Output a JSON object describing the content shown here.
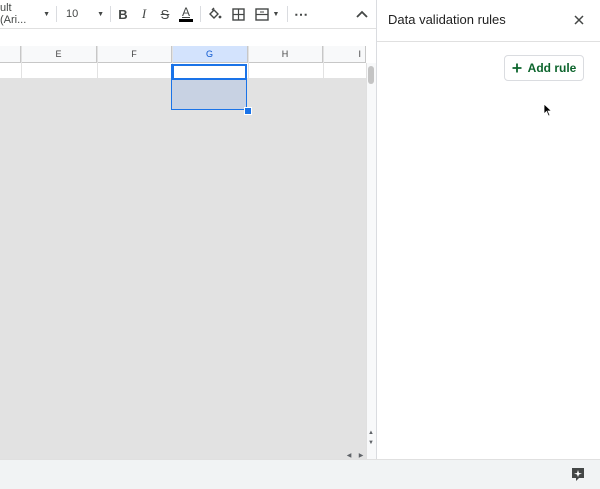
{
  "toolbar": {
    "font_name": "ult (Ari...",
    "font_size": "10",
    "bold_label": "B",
    "italic_label": "I",
    "strike_label": "S",
    "text_color_label": "A",
    "more_label": "⋯",
    "text_color": "#000000"
  },
  "columns": [
    "E",
    "F",
    "G",
    "H",
    "I"
  ],
  "selected_column": "G",
  "panel": {
    "title": "Data validation rules",
    "add_rule_label": "Add rule"
  },
  "colors": {
    "accent": "#1a73e8",
    "add_rule_green": "#0d652d"
  }
}
